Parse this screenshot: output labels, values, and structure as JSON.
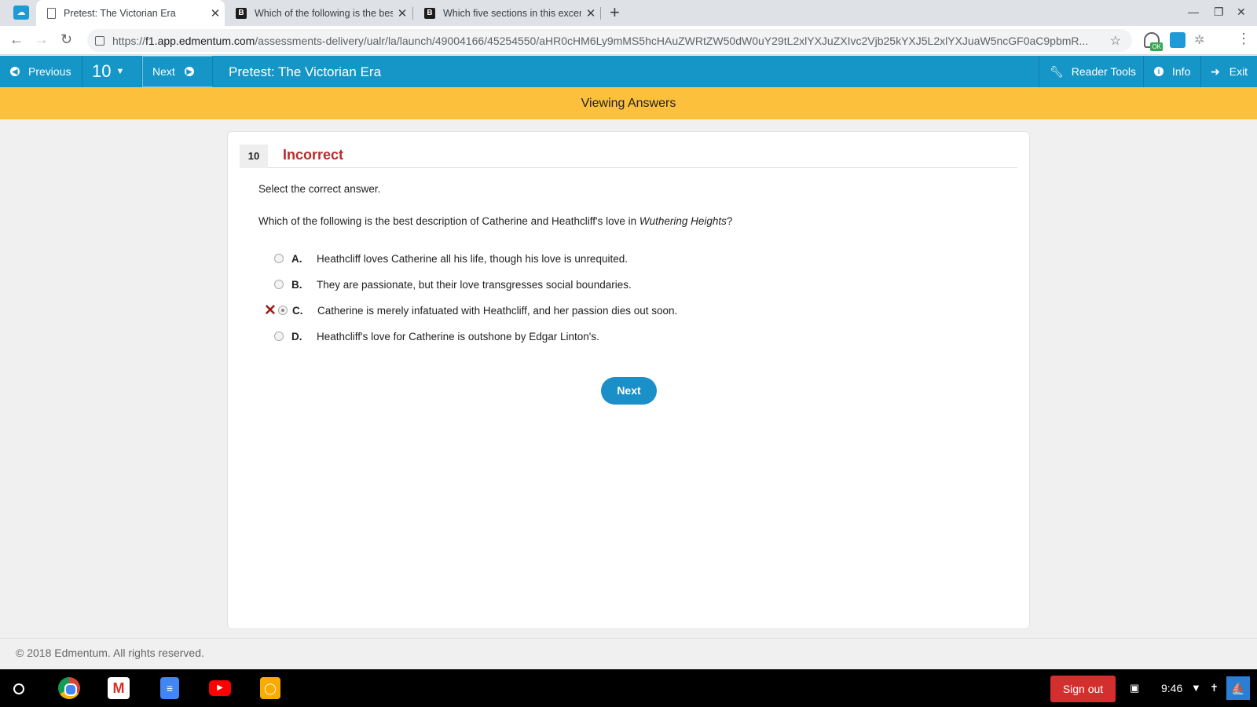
{
  "browser": {
    "tabs": [
      {
        "title": "Pretest: The Victorian Era",
        "active": true,
        "icon": "page-icon"
      },
      {
        "title": "Which of the following is the bes",
        "active": false,
        "icon": "brainly-icon"
      },
      {
        "title": "Which five sections in this excerp",
        "active": false,
        "icon": "brainly-icon"
      }
    ],
    "url_scheme": "https://",
    "url_host": "f1.app.edmentum.com",
    "url_path": "/assessments-delivery/ualr/la/launch/49004166/45254550/aHR0cHM6Ly9mMS5hcHAuZWRtZW50dW0uY29tL2xlYXJuZXIvc2Vjb25kYXJ5L2xlYXJuaW5ncGF0aC9pbmR...",
    "ext_badge": "OK"
  },
  "nav": {
    "previous_label": "Previous",
    "question_number": "10",
    "next_label": "Next",
    "title": "Pretest: The Victorian Era",
    "reader_tools_label": "Reader Tools",
    "info_label": "Info",
    "exit_label": "Exit"
  },
  "banner": {
    "text": "Viewing Answers"
  },
  "question": {
    "number": "10",
    "status": "Incorrect",
    "prompt": "Select the correct answer.",
    "text_before": "Which of the following is the best description of Catherine and Heathcliff's love in ",
    "text_italic": "Wuthering Heights",
    "text_after": "?",
    "choices": [
      {
        "letter": "A.",
        "text": "Heathcliff loves Catherine all his life, though his love is unrequited.",
        "selected": false
      },
      {
        "letter": "B.",
        "text": "They are passionate, but their love transgresses social boundaries.",
        "selected": false
      },
      {
        "letter": "C.",
        "text": "Catherine is merely infatuated with Heathcliff, and her passion dies out soon.",
        "selected": true,
        "marked_incorrect": true
      },
      {
        "letter": "D.",
        "text": "Heathcliff's love for Catherine is outshone by Edgar Linton's.",
        "selected": false
      }
    ],
    "next_button": "Next"
  },
  "footer": {
    "copyright": "© 2018 Edmentum. All rights reserved."
  },
  "shelf": {
    "apps": [
      "chrome-icon",
      "gmail-icon",
      "docs-icon",
      "youtube-icon",
      "keep-icon"
    ],
    "sign_out": "Sign out",
    "time": "9:46"
  },
  "colors": {
    "nav_bar": "#1596c6",
    "banner": "#fcc03c",
    "incorrect": "#b72d2d",
    "next_button": "#1a8fc8",
    "sign_out": "#d32f2f"
  }
}
